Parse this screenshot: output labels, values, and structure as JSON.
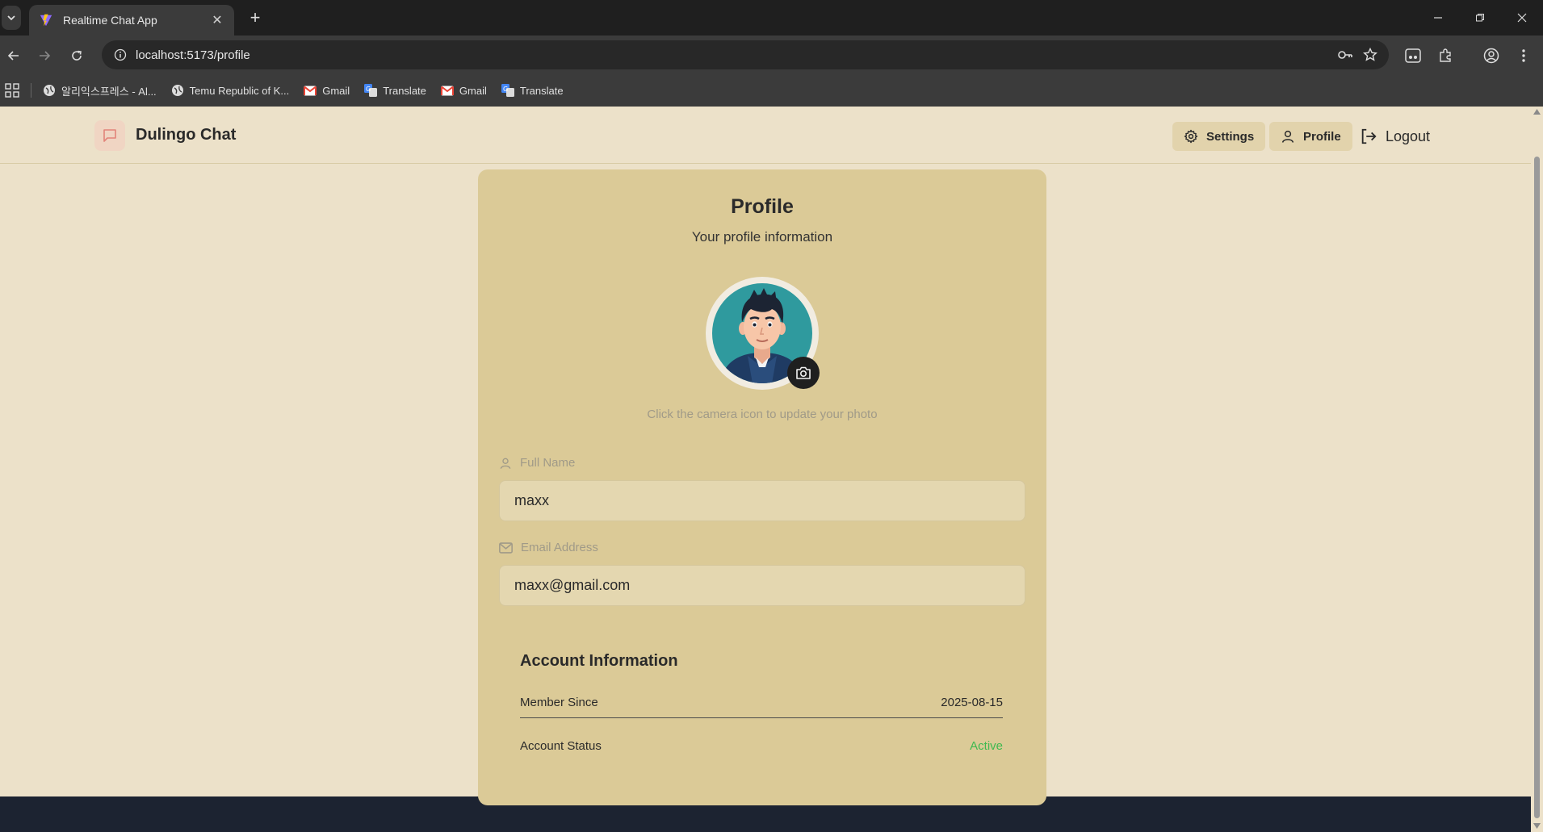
{
  "browser": {
    "tab_title": "Realtime Chat App",
    "url": "localhost:5173/profile",
    "bookmarks": [
      {
        "label": "알리익스프레스 - Al...",
        "icon": "globe-icon"
      },
      {
        "label": "Temu Republic of K...",
        "icon": "globe-icon"
      },
      {
        "label": "Gmail",
        "icon": "gmail-icon"
      },
      {
        "label": "Translate",
        "icon": "translate-icon"
      },
      {
        "label": "Gmail",
        "icon": "gmail-icon"
      },
      {
        "label": "Translate",
        "icon": "translate-icon"
      }
    ]
  },
  "header": {
    "brand": "Dulingo Chat",
    "settings_label": "Settings",
    "profile_label": "Profile",
    "logout_label": "Logout"
  },
  "profile": {
    "title": "Profile",
    "subtitle": "Your profile information",
    "photo_hint": "Click the camera icon to update your photo",
    "full_name_label": "Full Name",
    "full_name_value": "maxx",
    "email_label": "Email Address",
    "email_value": "maxx@gmail.com"
  },
  "account": {
    "title": "Account Information",
    "member_since_label": "Member Since",
    "member_since_value": "2025-08-15",
    "status_label": "Account Status",
    "status_value": "Active"
  },
  "colors": {
    "page_bg": "#ece1c9",
    "card_bg": "#dbca97",
    "active_status": "#3fb950"
  }
}
